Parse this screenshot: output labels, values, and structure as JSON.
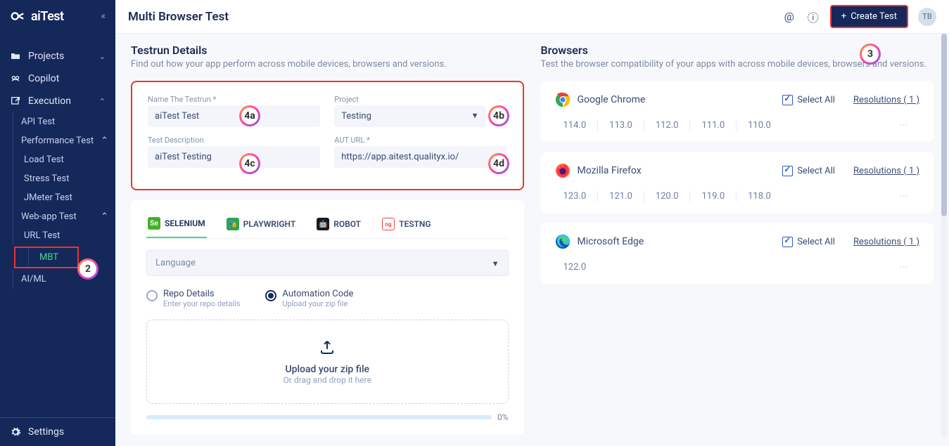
{
  "app": {
    "logo": "aiTest",
    "collapse": "«"
  },
  "sidebar": {
    "items": [
      {
        "label": "Projects",
        "icon": "folder",
        "chev": "⌄"
      },
      {
        "label": "Copilot",
        "icon": "copilot"
      },
      {
        "label": "Execution",
        "icon": "external",
        "chev": "⌃"
      }
    ],
    "exec": [
      "API Test",
      "Performance Test"
    ],
    "perf": [
      "Load Test",
      "Stress Test",
      "JMeter Test"
    ],
    "webapp_label": "Web-app Test",
    "webapp": [
      "URL Test",
      "MBT"
    ],
    "aiml": "AI/ML",
    "settings": "Settings"
  },
  "header": {
    "title": "Multi Browser Test",
    "create": "Create Test",
    "avatar": "TB"
  },
  "testrun": {
    "title": "Testrun Details",
    "desc": "Find out how your app perform across mobile devices, browsers and versions.",
    "name_label": "Name The Testrun *",
    "name_value": "aiTest Test",
    "project_label": "Project",
    "project_value": "Testing",
    "desc_label": "Test Description",
    "desc_value": "aiTest Testing",
    "aut_label": "AUT URL *",
    "aut_value": "https://app.aitest.qualityx.io/"
  },
  "auto": {
    "tabs": [
      {
        "label": "SELENIUM",
        "color": "#43b02a",
        "txt": "Se"
      },
      {
        "label": "PLAYWRIGHT",
        "color": "#e34f26",
        "txt": "🎭"
      },
      {
        "label": "ROBOT",
        "color": "#222",
        "txt": "🤖"
      },
      {
        "label": "TESTNG",
        "color": "#c44",
        "txt": ""
      }
    ],
    "language": "Language",
    "radios": [
      {
        "label": "Repo Details",
        "sub": "Enter your repo details"
      },
      {
        "label": "Automation Code",
        "sub": "Upload your zip file"
      }
    ],
    "upload_title": "Upload your zip file",
    "upload_sub": "Or drag and drop it here",
    "progress": "0%"
  },
  "browsers": {
    "title": "Browsers",
    "desc": "Test the browser compatibility of your apps with across mobile devices, browsers and versions.",
    "select_all": "Select All",
    "res_prefix": "Resolutions",
    "list": [
      {
        "name": "Google Chrome",
        "count": 1,
        "versions": [
          "114.0",
          "113.0",
          "112.0",
          "111.0",
          "110.0"
        ]
      },
      {
        "name": "Mozilla Firefox",
        "count": 1,
        "versions": [
          "123.0",
          "121.0",
          "120.0",
          "119.0",
          "118.0"
        ]
      },
      {
        "name": "Microsoft Edge",
        "count": 1,
        "versions": [
          "122.0"
        ]
      }
    ]
  },
  "annotations": {
    "2": "2",
    "3": "3",
    "4a": "4a",
    "4b": "4b",
    "4c": "4c",
    "4d": "4d"
  }
}
